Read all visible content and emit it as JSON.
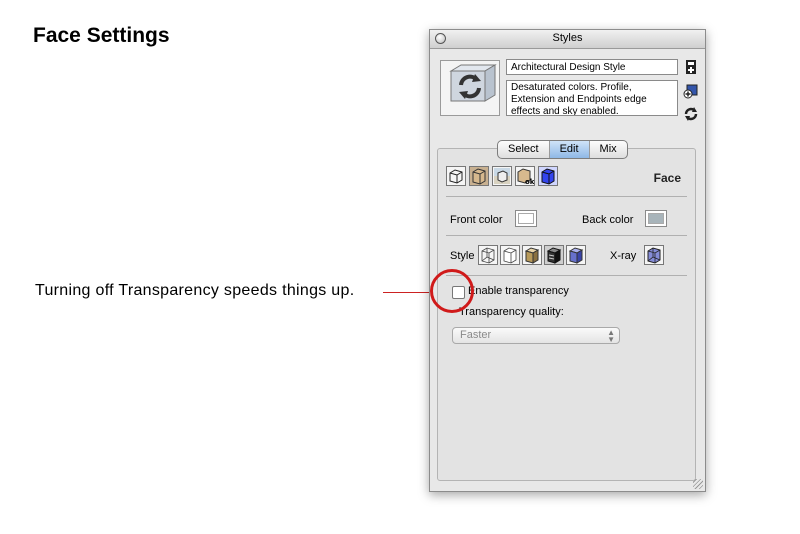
{
  "slide": {
    "title": "Face Settings",
    "callout": "Turning off Transparency speeds things up."
  },
  "window": {
    "title": "Styles",
    "style_name": "Architectural Design Style",
    "style_description": "Desaturated colors. Profile, Extension and Endpoints edge effects and sky enabled."
  },
  "tabs": [
    {
      "label": "Select"
    },
    {
      "label": "Edit",
      "active": true
    },
    {
      "label": "Mix"
    }
  ],
  "edit": {
    "section_label": "Face",
    "front_color_label": "Front color",
    "back_color_label": "Back color",
    "front_color": "#ffffff",
    "back_color": "#a8b4ba",
    "style_label": "Style",
    "xray_label": "X-ray",
    "transparency_label": "Enable transparency",
    "transparency_enabled": false,
    "quality_label": "Transparency quality:",
    "quality_value": "Faster"
  },
  "icons": {
    "settings": [
      "edge-settings-icon",
      "face-settings-icon",
      "background-settings-icon",
      "watermark-settings-icon",
      "modeling-settings-icon"
    ],
    "styles": [
      "wireframe-icon",
      "hidden-line-icon",
      "shaded-icon",
      "shaded-textures-icon",
      "monochrome-icon"
    ]
  }
}
